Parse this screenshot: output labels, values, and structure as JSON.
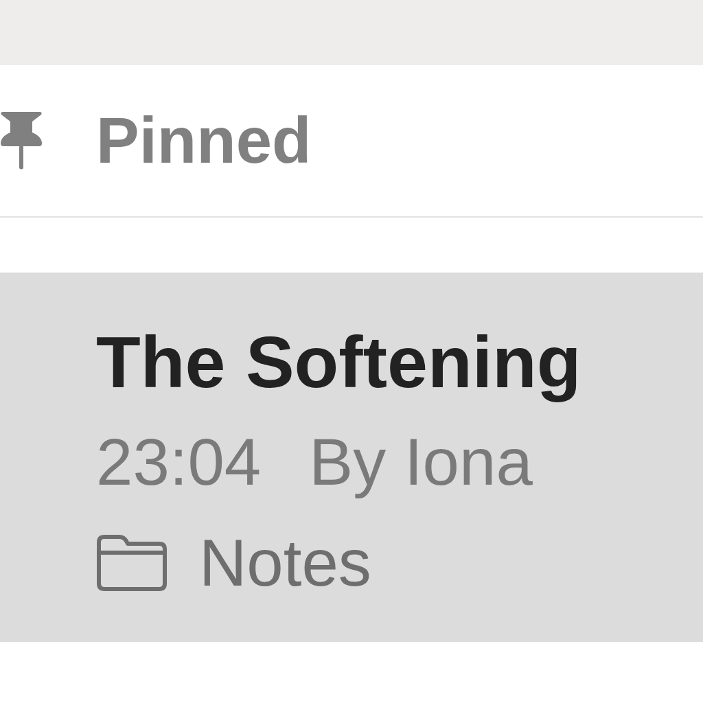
{
  "section": {
    "title": "Pinned"
  },
  "notes": [
    {
      "title": "The Softening",
      "time": "23:04",
      "author": "By Iona",
      "folder": "Notes",
      "selected": true
    }
  ]
}
